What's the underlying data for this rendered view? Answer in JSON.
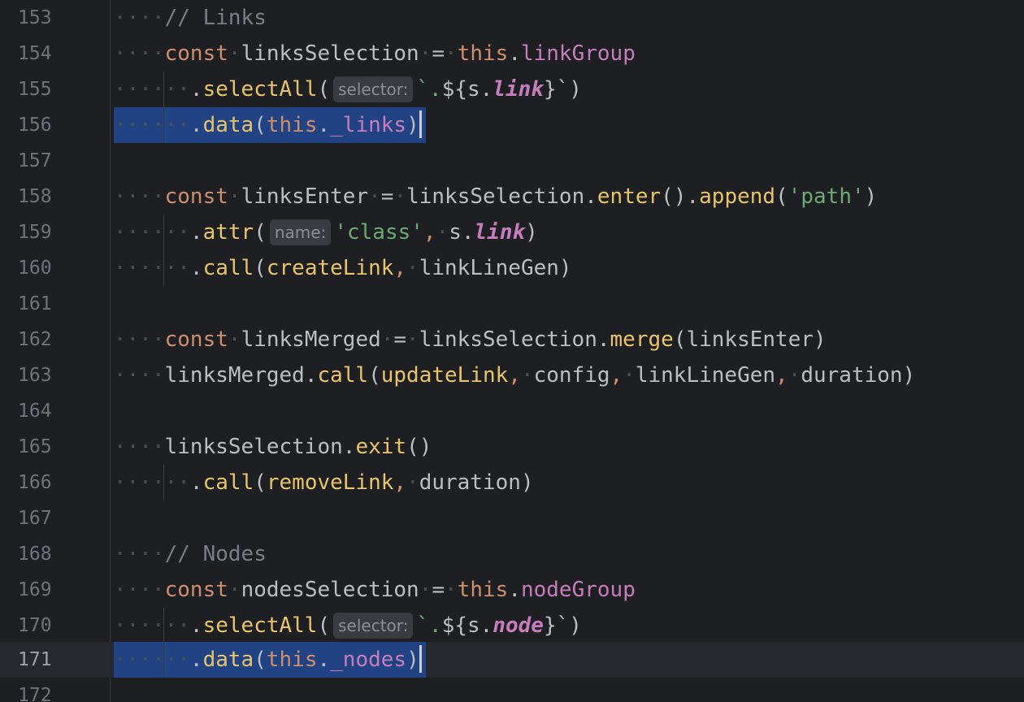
{
  "editor": {
    "language": "TypeScript",
    "theme_colors": {
      "background": "#1e1f22",
      "keyword": "#cf8e6d",
      "method": "#e8c46a",
      "property": "#c77dbb",
      "string": "#6aab73",
      "comment": "#7a7e85",
      "selection": "#214283"
    },
    "current_line": "171",
    "lines": [
      {
        "num": "153"
      },
      {
        "num": "154"
      },
      {
        "num": "155"
      },
      {
        "num": "156"
      },
      {
        "num": "157"
      },
      {
        "num": "158"
      },
      {
        "num": "159"
      },
      {
        "num": "160"
      },
      {
        "num": "161"
      },
      {
        "num": "162"
      },
      {
        "num": "163"
      },
      {
        "num": "164"
      },
      {
        "num": "165"
      },
      {
        "num": "166"
      },
      {
        "num": "167"
      },
      {
        "num": "168"
      },
      {
        "num": "169"
      },
      {
        "num": "170"
      },
      {
        "num": "171"
      },
      {
        "num": "172"
      }
    ],
    "tokens": {
      "l153": {
        "comment": "// Links"
      },
      "l154": {
        "kw": "const",
        "name": "linksSelection",
        "eq": "=",
        "this": "this",
        "dot": ".",
        "prop": "linkGroup"
      },
      "l155": {
        "dot": ".",
        "method": "selectAll",
        "open": "(",
        "hint": "selector:",
        "tpl_a": "`.",
        "tpl_b": "${",
        "id": "s.",
        "prop": "link",
        "tpl_c": "}`",
        "close": ")"
      },
      "l156": {
        "dot": ".",
        "method": "data",
        "open": "(",
        "this": "this",
        "dot2": ".",
        "prop": "_links",
        "close": ")"
      },
      "l158": {
        "kw": "const",
        "name": "linksEnter",
        "eq": "=",
        "obj": "linksSelection",
        "dot": ".",
        "m1": "enter",
        "p1": "()",
        "dot2": ".",
        "m2": "append",
        "open": "(",
        "str": "'path'",
        "close": ")"
      },
      "l159": {
        "dot": ".",
        "method": "attr",
        "open": "(",
        "hint": "name:",
        "str": "'class'",
        "comma": ",",
        "id": "s.",
        "prop": "link",
        "close": ")"
      },
      "l160": {
        "dot": ".",
        "method": "call",
        "open": "(",
        "fn": "createLink",
        "comma": ",",
        "arg": "linkLineGen",
        "close": ")"
      },
      "l162": {
        "kw": "const",
        "name": "linksMerged",
        "eq": "=",
        "obj": "linksSelection",
        "dot": ".",
        "method": "merge",
        "open": "(",
        "arg": "linksEnter",
        "close": ")"
      },
      "l163": {
        "obj": "linksMerged",
        "dot": ".",
        "method": "call",
        "open": "(",
        "fn": "updateLink",
        "c1": ",",
        "a1": "config",
        "c2": ",",
        "a2": "linkLineGen",
        "c3": ",",
        "a3": "duration",
        "close": ")"
      },
      "l165": {
        "obj": "linksSelection",
        "dot": ".",
        "method": "exit",
        "parens": "()"
      },
      "l166": {
        "dot": ".",
        "method": "call",
        "open": "(",
        "fn": "removeLink",
        "comma": ",",
        "arg": "duration",
        "close": ")"
      },
      "l168": {
        "comment": "// Nodes"
      },
      "l169": {
        "kw": "const",
        "name": "nodesSelection",
        "eq": "=",
        "this": "this",
        "dot": ".",
        "prop": "nodeGroup"
      },
      "l170": {
        "dot": ".",
        "method": "selectAll",
        "open": "(",
        "hint": "selector:",
        "tpl_a": "`.",
        "tpl_b": "${",
        "id": "s.",
        "prop": "node",
        "tpl_c": "}`",
        "close": ")"
      },
      "l171": {
        "dot": ".",
        "method": "data",
        "open": "(",
        "this": "this",
        "dot2": ".",
        "prop": "_nodes",
        "close": ")"
      }
    }
  }
}
